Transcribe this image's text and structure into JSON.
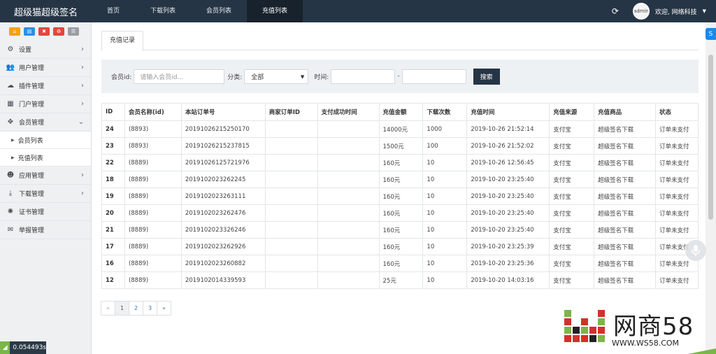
{
  "header": {
    "brand": "超级猫超级签名",
    "nav": [
      "首页",
      "下载列表",
      "会员列表",
      "充值列表"
    ],
    "active_nav": 3,
    "avatar_text": "admin",
    "user_label": "欢迎, 网络科技"
  },
  "sidebar": {
    "quick_buttons": [
      {
        "icon": "home-icon",
        "color": "#f0a21b",
        "glyph": "⌂"
      },
      {
        "icon": "file-icon",
        "color": "#2d8ee3",
        "glyph": "▤"
      },
      {
        "icon": "trash-icon",
        "color": "#e4463e",
        "glyph": "✖"
      },
      {
        "icon": "recycle-icon",
        "color": "#e4463e",
        "glyph": "♻"
      },
      {
        "icon": "list-icon",
        "color": "#9a9ea3",
        "glyph": "☰"
      }
    ],
    "items": [
      {
        "label": "设置",
        "icon": "gears-icon",
        "glyph": "⚙",
        "chevron": "›"
      },
      {
        "label": "用户管理",
        "icon": "users-icon",
        "glyph": "👥",
        "chevron": "›"
      },
      {
        "label": "插件管理",
        "icon": "cloud-icon",
        "glyph": "☁",
        "chevron": "›"
      },
      {
        "label": "门户管理",
        "icon": "grid-icon",
        "glyph": "▦",
        "chevron": "›"
      },
      {
        "label": "会员管理",
        "icon": "move-icon",
        "glyph": "✥",
        "chevron": "⌄"
      }
    ],
    "subitems": [
      "会员列表",
      "充值列表"
    ],
    "items_after": [
      {
        "label": "应用管理",
        "icon": "android-icon",
        "glyph": "☻",
        "chevron": "›"
      },
      {
        "label": "下载管理",
        "icon": "download-icon",
        "glyph": "⤓",
        "chevron": "›"
      },
      {
        "label": "证书管理",
        "icon": "certificate-icon",
        "glyph": "✺",
        "chevron": ""
      },
      {
        "label": "举报管理",
        "icon": "envelope-icon",
        "glyph": "✉",
        "chevron": ""
      }
    ],
    "timer": "0.054493s"
  },
  "tab": {
    "label": "充值记录"
  },
  "search": {
    "member_label": "会员id:",
    "member_placeholder": "请输入会员id...",
    "category_label": "分类:",
    "category_value": "全部",
    "time_label": "时间:",
    "dash": "-",
    "button": "搜索"
  },
  "table": {
    "headers": [
      "ID",
      "会员名称(id)",
      "本站订单号",
      "商家订单ID",
      "支付成功时间",
      "充值金额",
      "下载次数",
      "充值时间",
      "充值来源",
      "充值商品",
      "状态"
    ],
    "rows": [
      [
        "24",
        "(8893)",
        "20191026215250170",
        "",
        "",
        "14000元",
        "1000",
        "2019-10-26 21:52:14",
        "支付宝",
        "超级签名下载",
        "订单未支付"
      ],
      [
        "23",
        "(8893)",
        "20191026215237815",
        "",
        "",
        "1500元",
        "100",
        "2019-10-26 21:52:02",
        "支付宝",
        "超级签名下载",
        "订单未支付"
      ],
      [
        "22",
        "(8889)",
        "20191026125721976",
        "",
        "",
        "160元",
        "10",
        "2019-10-26 12:56:45",
        "支付宝",
        "超级签名下载",
        "订单未支付"
      ],
      [
        "18",
        "(8889)",
        "2019102023262245",
        "",
        "",
        "160元",
        "10",
        "2019-10-20 23:25:40",
        "支付宝",
        "超级签名下载",
        "订单未支付"
      ],
      [
        "19",
        "(8889)",
        "2019102023263111",
        "",
        "",
        "160元",
        "10",
        "2019-10-20 23:25:40",
        "支付宝",
        "超级签名下载",
        "订单未支付"
      ],
      [
        "20",
        "(8889)",
        "2019102023262476",
        "",
        "",
        "160元",
        "10",
        "2019-10-20 23:25:40",
        "支付宝",
        "超级签名下载",
        "订单未支付"
      ],
      [
        "21",
        "(8889)",
        "2019102023326246",
        "",
        "",
        "160元",
        "10",
        "2019-10-20 23:25:40",
        "支付宝",
        "超级签名下载",
        "订单未支付"
      ],
      [
        "17",
        "(8889)",
        "2019102023262926",
        "",
        "",
        "160元",
        "10",
        "2019-10-20 23:25:39",
        "支付宝",
        "超级签名下载",
        "订单未支付"
      ],
      [
        "16",
        "(8889)",
        "2019102023260882",
        "",
        "",
        "160元",
        "10",
        "2019-10-20 23:25:36",
        "支付宝",
        "超级签名下载",
        "订单未支付"
      ],
      [
        "12",
        "(8889)",
        "2019102014339593",
        "",
        "",
        "25元",
        "10",
        "2019-10-20 14:03:16",
        "支付宝",
        "超级签名下载",
        "订单未支付"
      ]
    ]
  },
  "pagination": {
    "prev": "«",
    "pages": [
      "1",
      "2",
      "3"
    ],
    "current": "1",
    "next": "»"
  },
  "watermark": {
    "text": "网商58",
    "sub": "WWW.WS58.COM"
  },
  "colors": {
    "topbar": "#263545",
    "accent_blue": "#337ab7",
    "search_btn": "#263545",
    "logo_green": "#7ab648",
    "logo_red": "#d4302a"
  }
}
